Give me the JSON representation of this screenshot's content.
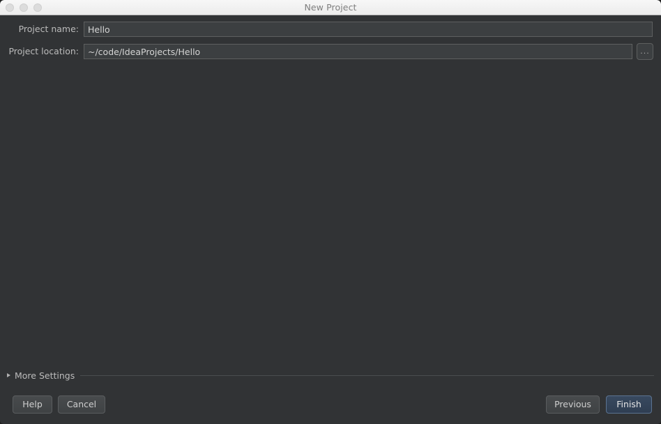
{
  "window": {
    "title": "New Project",
    "traffic_lights": [
      "close-button",
      "minimize-button",
      "zoom-button"
    ],
    "bg_color": "#313335",
    "titlebar_color": "#ececec"
  },
  "form": {
    "fields": [
      {
        "label": "Project name:",
        "value": "Hello",
        "placeholder": "",
        "name": "project-name"
      },
      {
        "label": "Project location:",
        "value": "~/code/IdeaProjects/Hello",
        "placeholder": "",
        "name": "project-location"
      }
    ],
    "browse_button_label": "..."
  },
  "more_settings": {
    "label": "More Settings",
    "expanded": false,
    "disclosure_icon": "triangle-right-icon"
  },
  "footer": {
    "help_label": "Help",
    "cancel_label": "Cancel",
    "previous_label": "Previous",
    "finish_label": "Finish",
    "default_button": "Finish",
    "accent_color": "#38495f"
  }
}
